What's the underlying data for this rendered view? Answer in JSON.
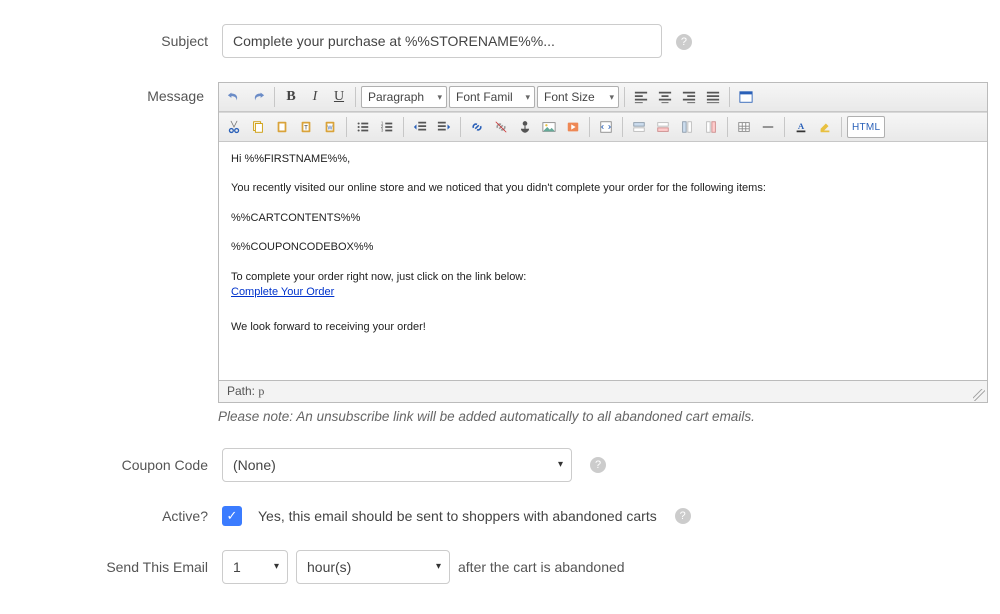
{
  "labels": {
    "subject": "Subject",
    "message": "Message",
    "coupon": "Coupon Code",
    "active": "Active?",
    "send": "Send This Email"
  },
  "subject_value": "Complete your purchase at %%STORENAME%%...",
  "toolbar": {
    "paragraph": "Paragraph",
    "font_family": "Font Famil",
    "font_size": "Font Size",
    "html": "HTML"
  },
  "editor": {
    "line1": "Hi %%FIRSTNAME%%,",
    "line2": "You recently visited our online store and we noticed that you didn't complete your order for the following items:",
    "line3": "%%CARTCONTENTS%%",
    "line4": "%%COUPONCODEBOX%%",
    "line5": "To complete your order right now, just click on the link below:",
    "link_text": "Complete Your Order",
    "line6": "We look forward to receiving your order!",
    "path_label": "Path:",
    "path_value": "p"
  },
  "note": "Please note: An unsubscribe link will be added automatically to all abandoned cart emails.",
  "coupon_value": "(None)",
  "active_text": "Yes, this email should be sent to shoppers with abandoned carts",
  "send_num": "1",
  "send_unit": "hour(s)",
  "send_after": "after the cart is abandoned"
}
